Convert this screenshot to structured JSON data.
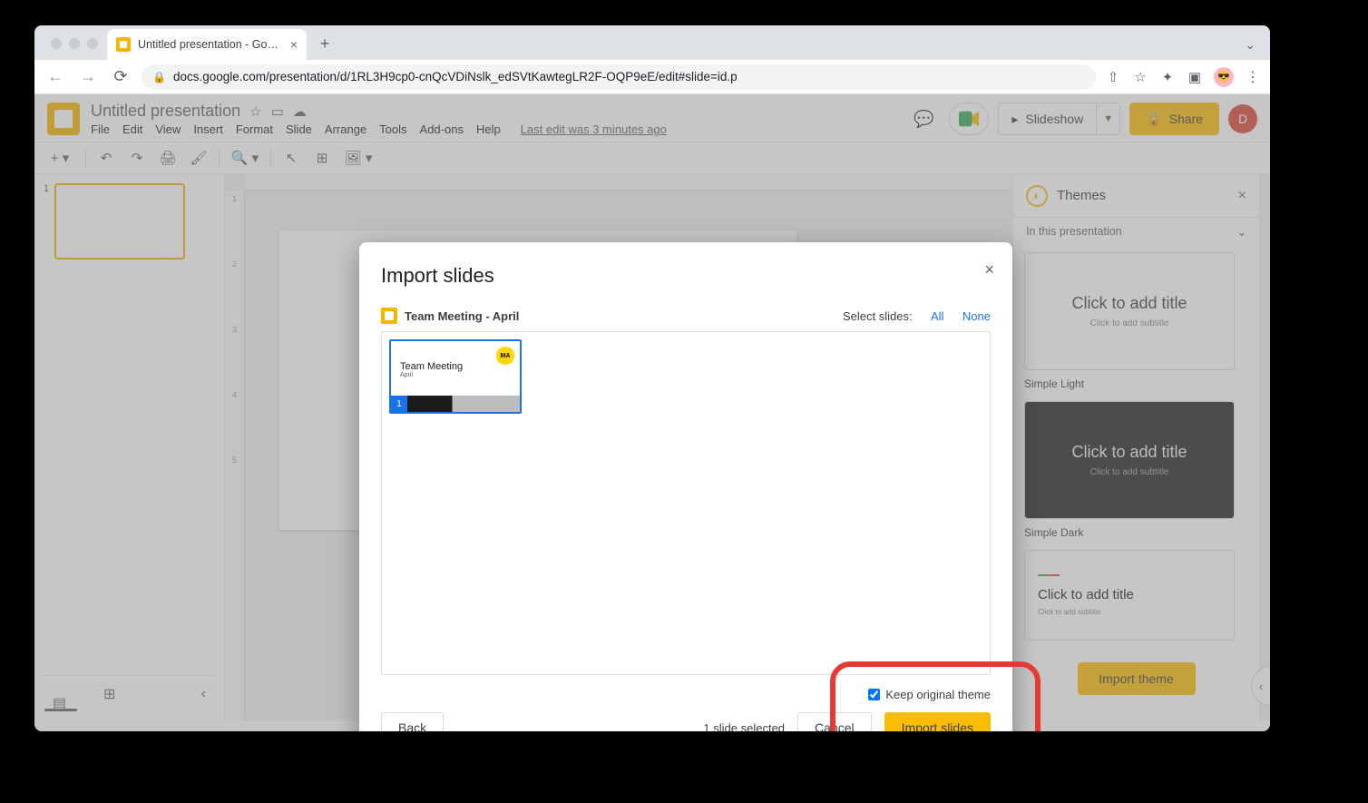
{
  "browser": {
    "tab_title": "Untitled presentation - Google",
    "url": "docs.google.com/presentation/d/1RL3H9cp0-cnQcVDiNslk_edSVtKawtegLR2F-OQP9eE/edit#slide=id.p"
  },
  "app": {
    "doc_title": "Untitled presentation",
    "menus": [
      "File",
      "Edit",
      "View",
      "Insert",
      "Format",
      "Slide",
      "Arrange",
      "Tools",
      "Add-ons",
      "Help"
    ],
    "last_edit": "Last edit was 3 minutes ago",
    "slideshow_label": "Slideshow",
    "share_label": "Share",
    "user_initial": "D",
    "thumb_number": "1"
  },
  "themes": {
    "panel_title": "Themes",
    "subheader": "In this presentation",
    "card_title": "Click to add title",
    "card_subtitle": "Click to add subtitle",
    "light_label": "Simple Light",
    "dark_label": "Simple Dark",
    "list3_title": "Click to add title",
    "list3_sub": "Click to add subtitle",
    "import_label": "Import theme"
  },
  "modal": {
    "title": "Import slides",
    "source_name": "Team Meeting - April",
    "select_label": "Select slides:",
    "select_all": "All",
    "select_none": "None",
    "slide_thumb": {
      "badge": "MA",
      "title": "Team Meeting",
      "subtitle": "April",
      "number": "1"
    },
    "keep_theme": "Keep original theme",
    "status": "1 slide selected",
    "back": "Back",
    "cancel": "Cancel",
    "import": "Import slides"
  },
  "ruler_ticks": [
    "",
    "1",
    "2",
    "3",
    "4",
    "5"
  ]
}
